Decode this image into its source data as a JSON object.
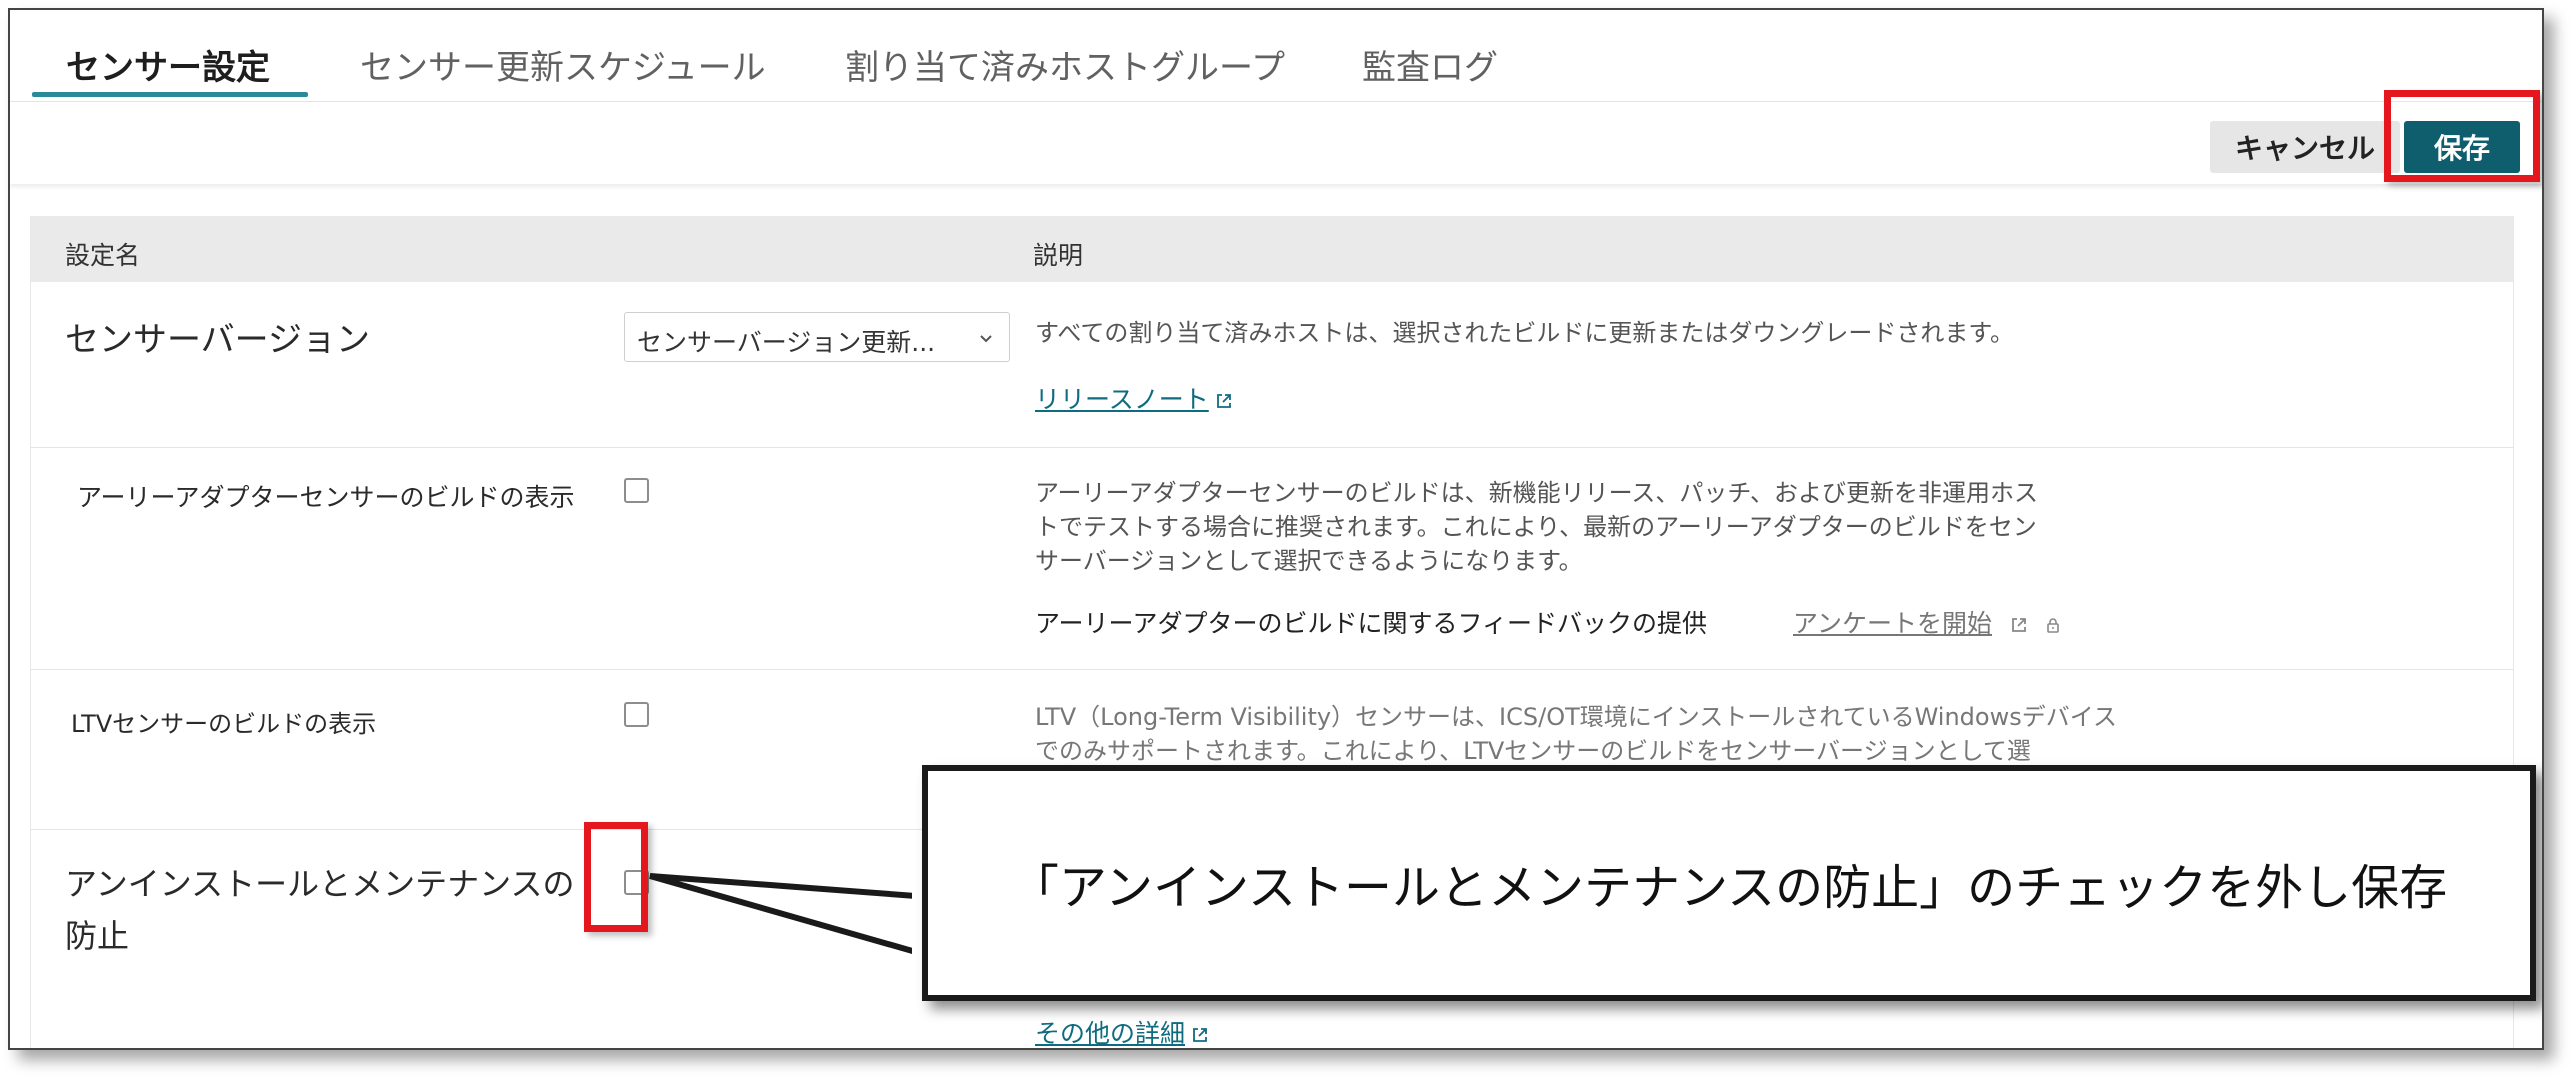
{
  "tabs": [
    {
      "label": "センサー設定",
      "active": true
    },
    {
      "label": "センサー更新スケジュール",
      "active": false
    },
    {
      "label": "割り当て済みホストグループ",
      "active": false
    },
    {
      "label": "監査ログ",
      "active": false
    }
  ],
  "actions": {
    "cancel_label": "キャンセル",
    "save_label": "保存"
  },
  "table": {
    "header": {
      "name": "設定名",
      "description": "説明"
    },
    "rows": [
      {
        "name": "センサーバージョン",
        "select_value": "センサーバージョン更新...",
        "description_lines": [
          "すべての割り当て済みホストは、選択されたビルドに更新またはダウングレードされます。"
        ],
        "link": "リリースノート"
      },
      {
        "name": "アーリーアダプターセンサーのビルドの表示",
        "checked": false,
        "description_lines": [
          "アーリーアダプターセンサーのビルドは、新機能リリース、パッチ、および更新を非運用ホス",
          "トでテストする場合に推奨されます。これにより、最新のアーリーアダプターのビルドをセン",
          "サーバージョンとして選択できるようになります。"
        ],
        "feedback_label": "アーリーアダプターのビルドに関するフィードバックの提供",
        "feedback_link": "アンケートを開始"
      },
      {
        "name": "LTVセンサーのビルドの表示",
        "checked": false,
        "description_lines": [
          "LTV（Long-Term Visibility）センサーは、ICS/OT環境にインストールされているWindowsデバイス",
          "でのみサポートされます。これにより、LTVセンサーのビルドをセンサーバージョンとして選"
        ]
      },
      {
        "name_lines": [
          "アンインストールとメンテナンスの",
          "防止"
        ],
        "checked": false,
        "link": "その他の詳細"
      }
    ]
  },
  "callout": {
    "text": "「アンインストールとメンテナンスの防止」のチェックを外し保存"
  },
  "colors": {
    "accent": "#2a8a9a",
    "save_button": "#0e5e6e",
    "highlight": "#e3171d",
    "link": "#0f6c80"
  }
}
